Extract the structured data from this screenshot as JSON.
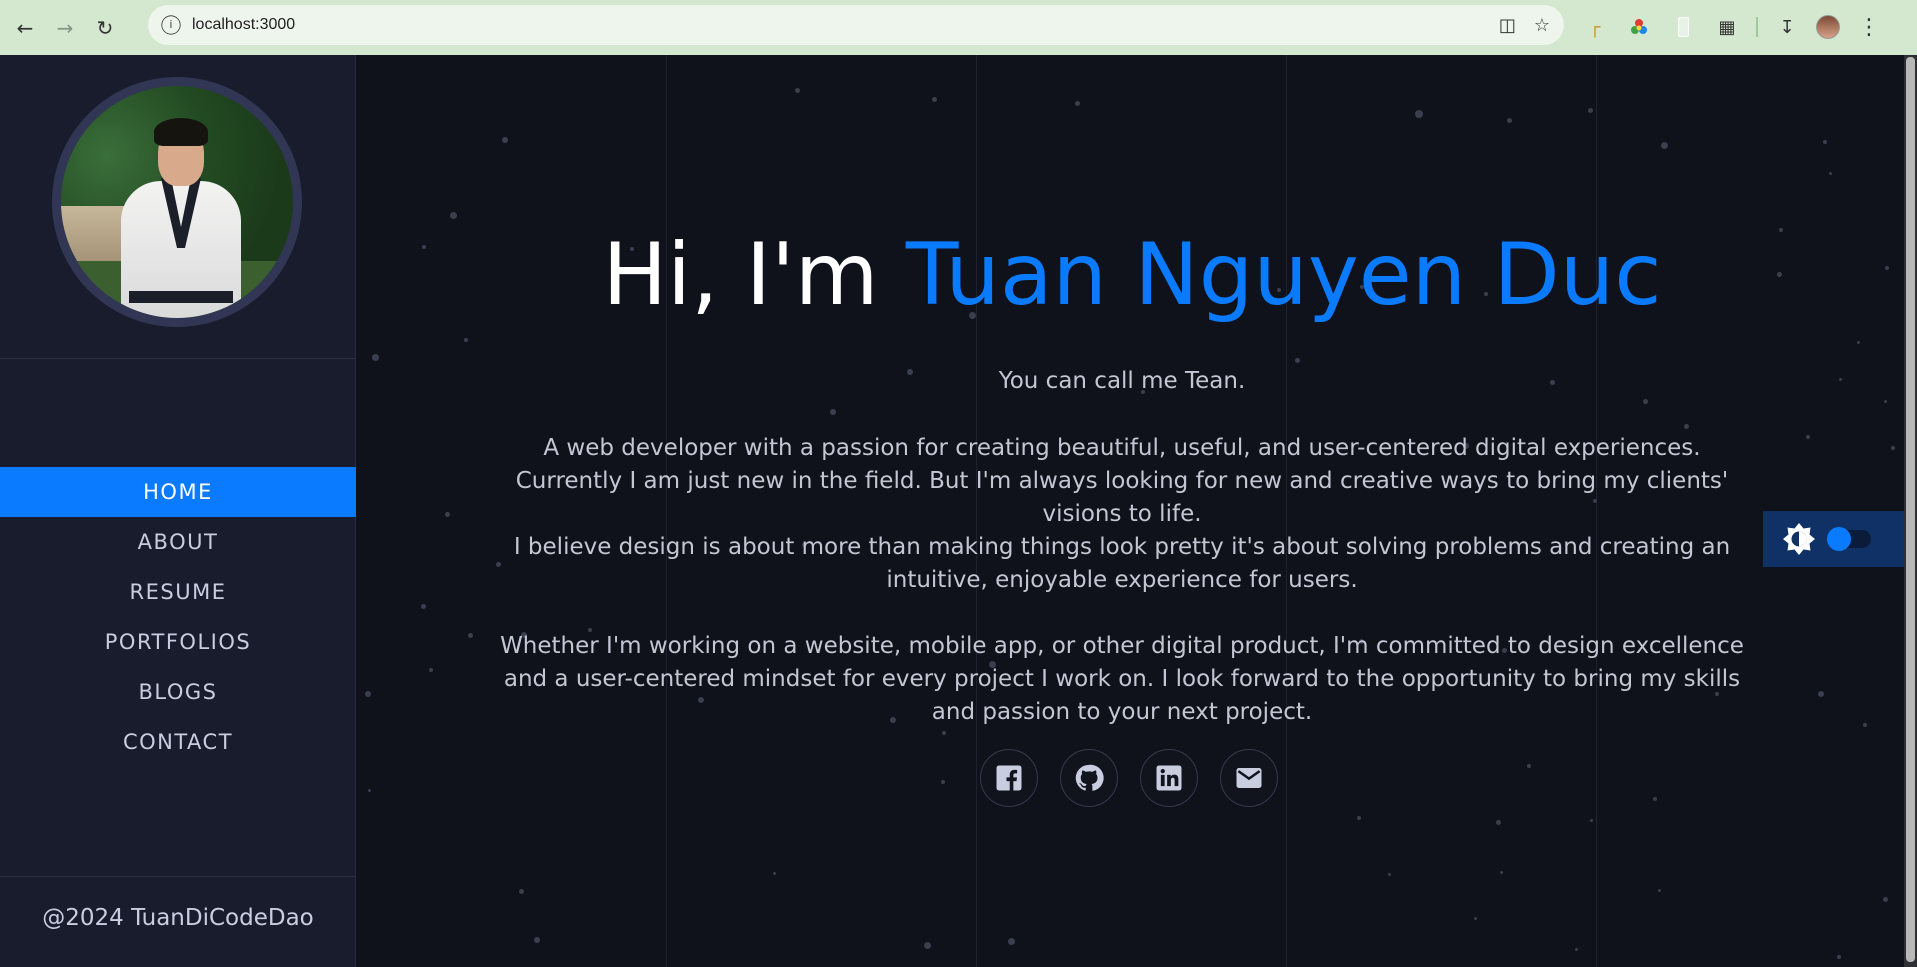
{
  "browser": {
    "url": "localhost:3000"
  },
  "sidebar": {
    "menu": [
      {
        "label": "HOME",
        "active": true
      },
      {
        "label": "ABOUT",
        "active": false
      },
      {
        "label": "RESUME",
        "active": false
      },
      {
        "label": "PORTFOLIOS",
        "active": false
      },
      {
        "label": "BLOGS",
        "active": false
      },
      {
        "label": "CONTACT",
        "active": false
      }
    ],
    "footer": "@2024 TuanDiCodeDao"
  },
  "hero": {
    "greeting": "Hi, I'm ",
    "name": "Tuan Nguyen Duc",
    "nickname": "You can call me Tean.",
    "paragraph1": "A web developer with a passion for creating beautiful, useful, and user-centered digital experiences. Currently I am just new in the field. But I'm always looking for new and creative ways to bring my clients' visions to life.",
    "paragraph2": "I believe design is about more than making things look pretty it's about solving problems and creating an intuitive, enjoyable experience for users.",
    "paragraph3": "Whether I'm working on a website, mobile app, or other digital product, I'm committed to design excellence and a user-centered mindset for every project I work on. I look forward to the opportunity to bring my skills and passion to your next project."
  },
  "socials": [
    {
      "icon": "facebook-icon"
    },
    {
      "icon": "github-icon"
    },
    {
      "icon": "linkedin-icon"
    },
    {
      "icon": "email-icon"
    }
  ],
  "theme_toggle": {
    "dark_mode": false
  },
  "colors": {
    "accent": "#0a7bff",
    "sidebar_bg": "#191c2c",
    "main_bg": "#10121b"
  }
}
